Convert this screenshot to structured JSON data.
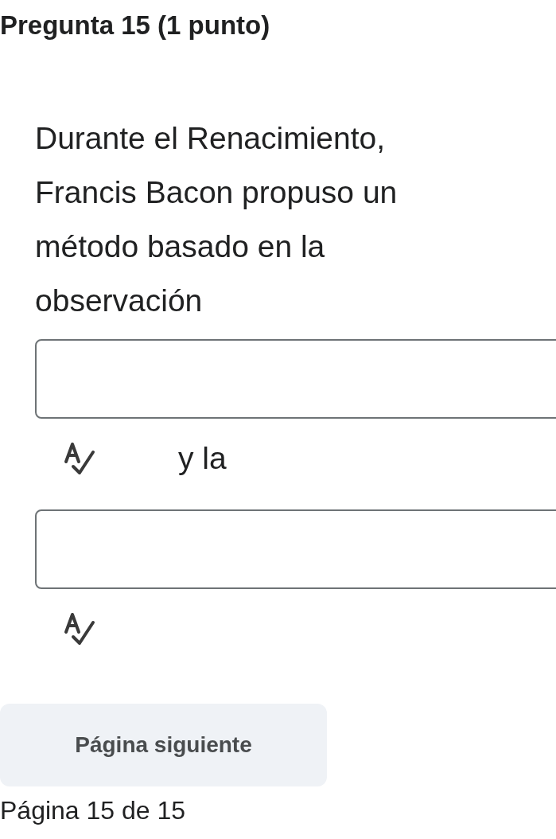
{
  "question": {
    "title": "Pregunta 15 (1 punto)",
    "segments": [
      {
        "kind": "text",
        "text": "Durante el Renacimiento, Francis Bacon propuso un método basado en la observación"
      },
      {
        "kind": "blank"
      },
      {
        "kind": "text",
        "text": "y la"
      },
      {
        "kind": "blank"
      }
    ]
  },
  "next_button": "Página siguiente",
  "page_indicator": "Página 15 de 15"
}
